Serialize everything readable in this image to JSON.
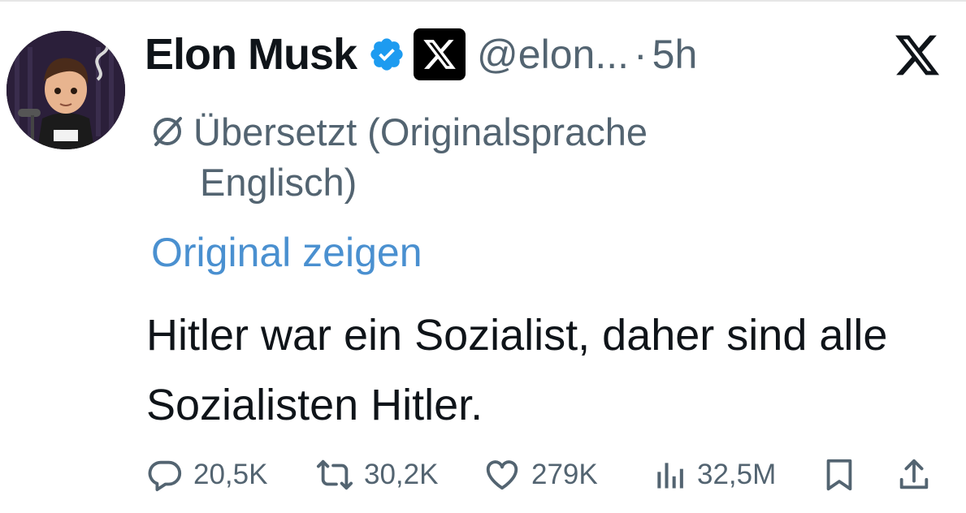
{
  "author": {
    "display_name": "Elon Musk",
    "handle": "@elon...",
    "separator": "·",
    "time": "5h"
  },
  "translation": {
    "line1": "Übersetzt (Originalsprache",
    "line2": "Englisch)",
    "show_original_label": "Original zeigen"
  },
  "tweet": {
    "text": "Hitler war ein Sozialist, daher sind alle Sozialisten Hitler."
  },
  "actions": {
    "replies": "20,5K",
    "reposts": "30,2K",
    "likes": "279K",
    "views": "32,5M"
  },
  "colors": {
    "text_primary": "#0f1419",
    "text_secondary": "#536471",
    "link": "#4a90d0",
    "verified": "#1d9bf0"
  },
  "icons": {
    "verified": "verified-badge-icon",
    "affiliate": "x-logo-icon",
    "more": "x-logo-icon",
    "translate": "translate-icon",
    "reply": "reply-icon",
    "repost": "repost-icon",
    "like": "heart-icon",
    "views": "views-icon",
    "bookmark": "bookmark-icon",
    "share": "share-icon"
  }
}
